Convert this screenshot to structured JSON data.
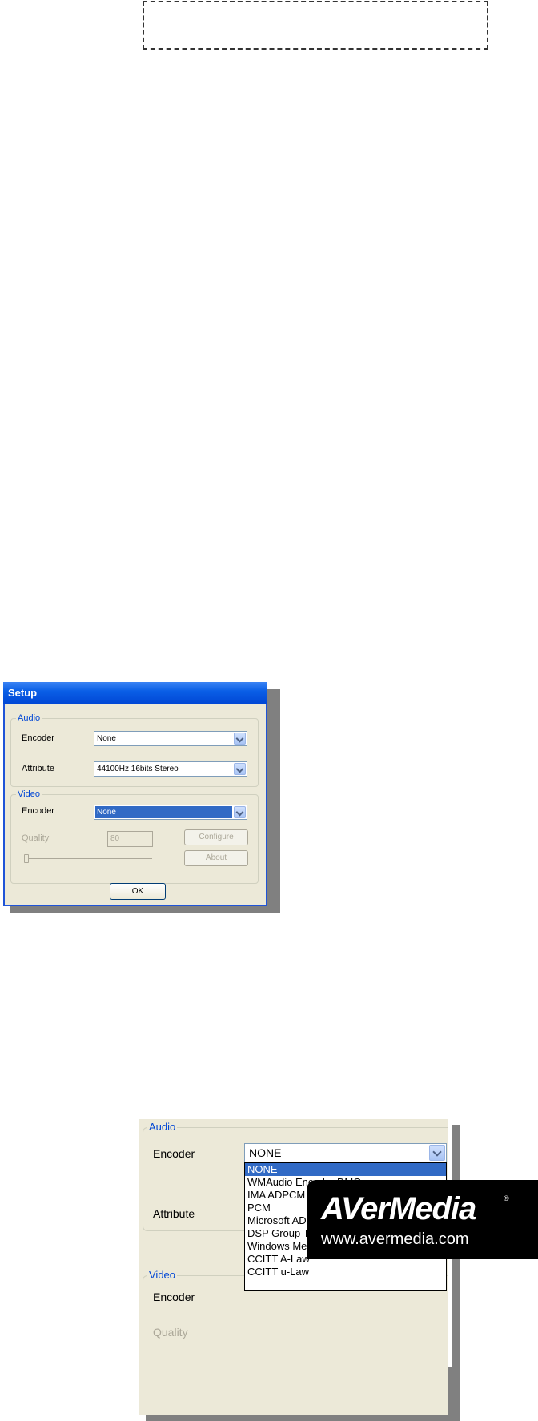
{
  "dialog": {
    "title": "Setup",
    "audio": {
      "group_label": "Audio",
      "encoder_label": "Encoder",
      "encoder_value": "None",
      "attribute_label": "Attribute",
      "attribute_value": "44100Hz  16bits Stereo"
    },
    "video": {
      "group_label": "Video",
      "encoder_label": "Encoder",
      "encoder_value": "None",
      "quality_label": "Quality",
      "quality_value": "80",
      "configure_button": "Configure",
      "about_button": "About"
    },
    "ok_button": "OK"
  },
  "zoomed": {
    "audio_label": "Audio",
    "encoder_label": "Encoder",
    "attribute_label": "Attribute",
    "video_label": "Video",
    "video_encoder_label": "Encoder",
    "quality_label": "Quality",
    "encoder_value": "NONE",
    "options": [
      "NONE",
      "WMAudio Encoder DMO",
      "IMA ADPCM",
      "PCM",
      "Microsoft ADPCM",
      "DSP Group TrueSpeech(TM)",
      "Windows Media Audio V2",
      "CCITT A-Law",
      "CCITT u-Law"
    ],
    "selected_option": "NONE"
  },
  "logo": {
    "brand": "AVerMedia",
    "url": "www.avermedia.com",
    "registered": "®"
  }
}
